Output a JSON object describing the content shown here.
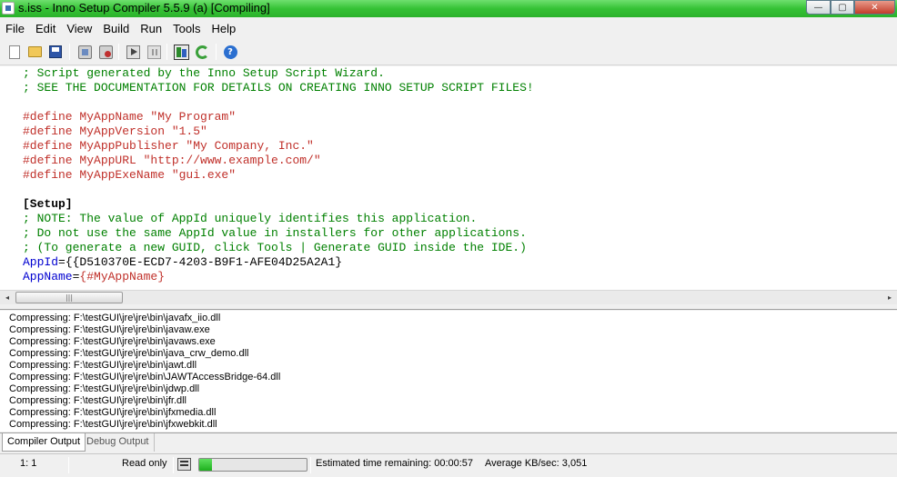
{
  "window": {
    "title": "s.iss - Inno Setup Compiler 5.5.9 (a)  [Compiling]",
    "minimize_glyph": "—",
    "maximize_glyph": "▢",
    "close_glyph": "✕"
  },
  "menu": [
    "File",
    "Edit",
    "View",
    "Build",
    "Run",
    "Tools",
    "Help"
  ],
  "toolbar": {
    "icons": [
      "new-file-icon",
      "open-file-icon",
      "save-icon",
      "wizard-icon",
      "stop-icon",
      "run-icon",
      "pause-icon",
      "compile-icon",
      "refresh-icon",
      "help-icon"
    ],
    "help_glyph": "?"
  },
  "editor": {
    "lines": [
      [
        {
          "t": "; Script generated by the Inno Setup Script Wizard.",
          "c": "comment"
        }
      ],
      [
        {
          "t": "; SEE THE DOCUMENTATION FOR DETAILS ON CREATING INNO SETUP SCRIPT FILES!",
          "c": "comment"
        }
      ],
      [],
      [
        {
          "t": "#define MyAppName \"My Program\"",
          "c": "define"
        }
      ],
      [
        {
          "t": "#define MyAppVersion \"1.5\"",
          "c": "define"
        }
      ],
      [
        {
          "t": "#define MyAppPublisher \"My Company, Inc.\"",
          "c": "define"
        }
      ],
      [
        {
          "t": "#define MyAppURL \"http://www.example.com/\"",
          "c": "define"
        }
      ],
      [
        {
          "t": "#define MyAppExeName \"gui.exe\"",
          "c": "define"
        }
      ],
      [],
      [
        {
          "t": "[Setup]",
          "c": "section"
        }
      ],
      [
        {
          "t": "; NOTE: The value of AppId uniquely identifies this application.",
          "c": "comment"
        }
      ],
      [
        {
          "t": "; Do not use the same AppId value in installers for other applications.",
          "c": "comment"
        }
      ],
      [
        {
          "t": "; (To generate a new GUID, click Tools | Generate GUID inside the IDE.)",
          "c": "comment"
        }
      ],
      [
        {
          "t": "AppId",
          "c": "key"
        },
        {
          "t": "={{D510370E-ECD7-4203-B9F1-AFE04D25A2A1}",
          "c": "val"
        }
      ],
      [
        {
          "t": "AppName",
          "c": "key"
        },
        {
          "t": "=",
          "c": "val"
        },
        {
          "t": "{#MyAppName}",
          "c": "const"
        }
      ]
    ]
  },
  "scrollbar": {
    "left_arrow": "◂",
    "right_arrow": "▸",
    "thumb_grip": "|||"
  },
  "output": {
    "lines": [
      "Compressing: F:\\testGUI\\jre\\jre\\bin\\javafx_iio.dll",
      "Compressing: F:\\testGUI\\jre\\jre\\bin\\javaw.exe",
      "Compressing: F:\\testGUI\\jre\\jre\\bin\\javaws.exe",
      "Compressing: F:\\testGUI\\jre\\jre\\bin\\java_crw_demo.dll",
      "Compressing: F:\\testGUI\\jre\\jre\\bin\\jawt.dll",
      "Compressing: F:\\testGUI\\jre\\jre\\bin\\JAWTAccessBridge-64.dll",
      "Compressing: F:\\testGUI\\jre\\jre\\bin\\jdwp.dll",
      "Compressing: F:\\testGUI\\jre\\jre\\bin\\jfr.dll",
      "Compressing: F:\\testGUI\\jre\\jre\\bin\\jfxmedia.dll",
      "Compressing: F:\\testGUI\\jre\\jre\\bin\\jfxwebkit.dll"
    ]
  },
  "tabs": {
    "compiler_output": "Compiler Output",
    "debug_output": "Debug Output"
  },
  "status": {
    "position": "1:   1",
    "mode": "Read only",
    "progress": 0.12,
    "time_remaining": "Estimated time remaining: 00:00:57",
    "average_speed": "Average KB/sec: 3,051"
  }
}
